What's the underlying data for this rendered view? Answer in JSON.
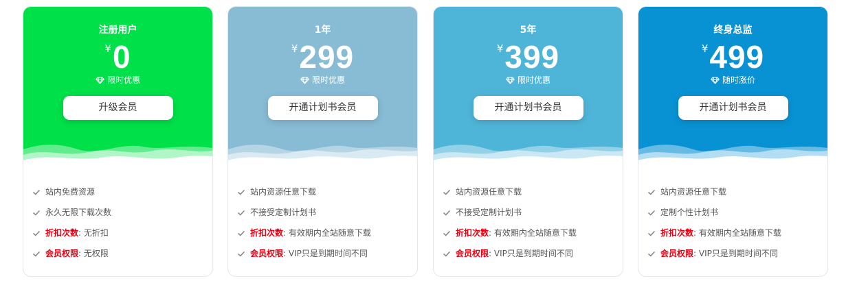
{
  "currency_symbol": "¥",
  "plans": [
    {
      "name": "注册用户",
      "price": "0",
      "tagline": "限时优惠",
      "button": "升级会员",
      "color": "#00e048",
      "features": [
        {
          "text": "站内免费资源"
        },
        {
          "text": "永久无限下载次数"
        },
        {
          "label": "折扣次数",
          "sep": ":",
          "text": "无折扣"
        },
        {
          "label": "会员权限",
          "sep": ":",
          "text": "无权限"
        }
      ]
    },
    {
      "name": "1年",
      "price": "299",
      "tagline": "限时优惠",
      "button": "开通计划书会员",
      "color": "#88bcd5",
      "features": [
        {
          "text": "站内资源任意下载"
        },
        {
          "text": "不接受定制计划书"
        },
        {
          "label": "折扣次数",
          "sep": ":",
          "text": "有效期内全站随意下载"
        },
        {
          "label": "会员权限",
          "sep": ":",
          "text": "VIP只是到期时间不同"
        }
      ]
    },
    {
      "name": "5年",
      "price": "399",
      "tagline": "限时优惠",
      "button": "开通计划书会员",
      "color": "#4fb5d8",
      "features": [
        {
          "text": "站内资源任意下载"
        },
        {
          "text": "不接受定制计划书"
        },
        {
          "label": "折扣次数",
          "sep": ":",
          "text": "有效期内全站随意下载"
        },
        {
          "label": "会员权限",
          "sep": ":",
          "text": "VIP只是到期时间不同"
        }
      ]
    },
    {
      "name": "终身总监",
      "price": "499",
      "tagline": "随时涨价",
      "button": "开通计划书会员",
      "color": "#0892d3",
      "features": [
        {
          "text": "站内资源任意下载"
        },
        {
          "text": "定制个性计划书"
        },
        {
          "label": "折扣次数",
          "sep": ":",
          "text": "有效期内全站随意下载"
        },
        {
          "label": "会员权限",
          "sep": ":",
          "text": "VIP只是到期时间不同"
        }
      ]
    }
  ]
}
